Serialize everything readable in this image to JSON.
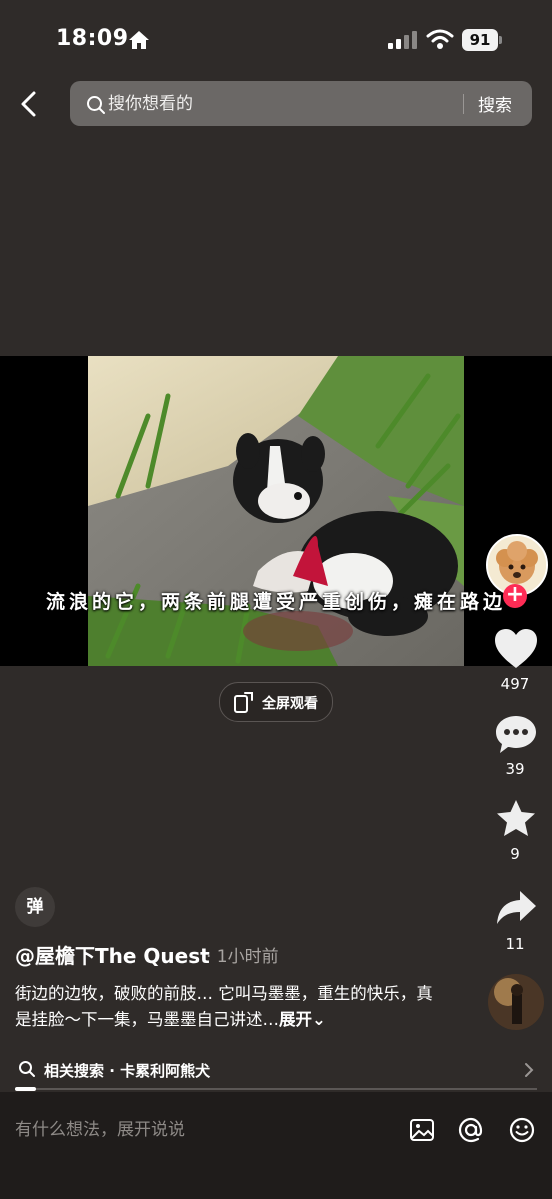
{
  "status_bar": {
    "time": "18:09",
    "battery": "91"
  },
  "search": {
    "placeholder": "搜你想看的",
    "button_label": "搜索"
  },
  "video": {
    "subtitle": "流浪的它，两条前腿遭受严重创伤，瘫在路边",
    "fullscreen_label": "全屏观看"
  },
  "actions": {
    "likes": "497",
    "comments": "39",
    "favorites": "9",
    "shares": "11",
    "follow_symbol": "+"
  },
  "post": {
    "danmu_label": "弹",
    "author": "@屋檐下The Quest",
    "time": "· 1小时前",
    "description": "街边的边牧，破败的前肢… 它叫马墨墨，重生的快乐，真是挂脸～下一集，马墨墨自己讲述…",
    "expand_label": "展开⌄"
  },
  "related": {
    "text": "相关搜索 · 卡累利阿熊犬"
  },
  "progress": {
    "fraction": 0.04
  },
  "comment_bar": {
    "placeholder": "有什么想法，展开说说"
  },
  "colors": {
    "accent": "#fe2c55",
    "background": "#2f2b29"
  }
}
